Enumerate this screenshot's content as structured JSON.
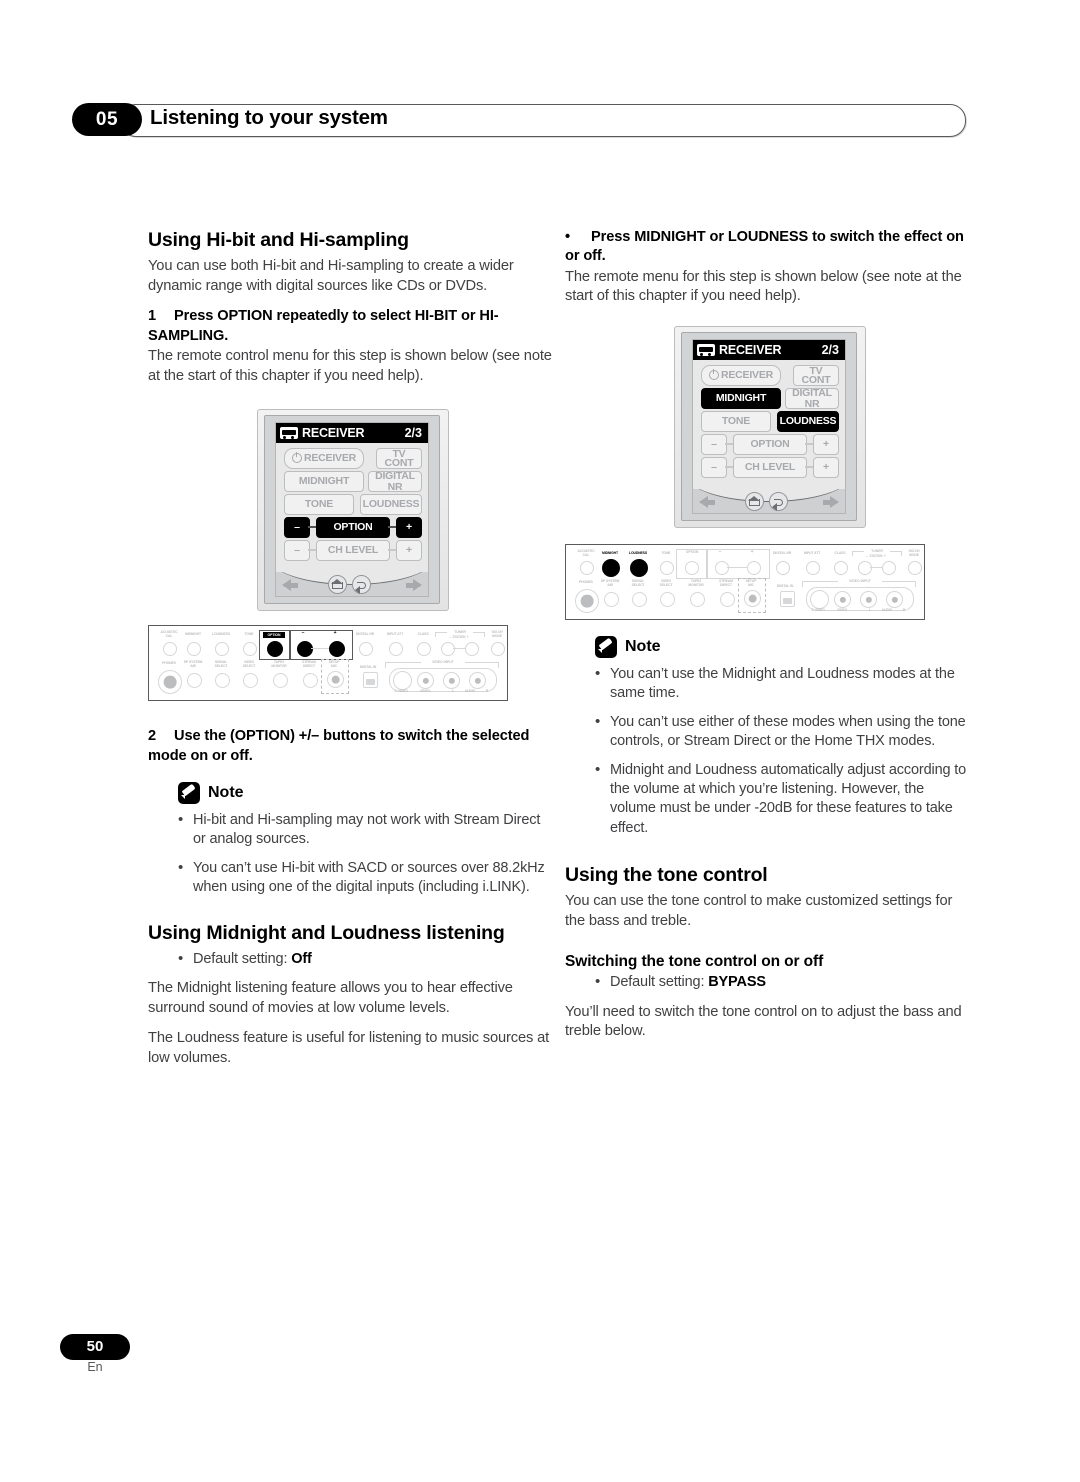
{
  "header": {
    "chapter_number": "05",
    "title": "Listening to your system"
  },
  "footer": {
    "page_number": "50",
    "language": "En"
  },
  "left_column": {
    "section1_heading": "Using Hi-bit and Hi-sampling",
    "section1_intro": "You can use both Hi-bit and Hi-sampling to create a wider dynamic range with digital sources like CDs or DVDs.",
    "step1_number": "1",
    "step1_title": "Press OPTION repeatedly to select HI-BIT or HI-SAMPLING.",
    "step1_body": "The remote control menu for this step is shown below (see note at the start of this chapter if you need help).",
    "step2_number": "2",
    "step2_title": "Use the (OPTION) +/– buttons to switch the selected mode on or off.",
    "note_label": "Note",
    "notes": [
      "Hi-bit and Hi-sampling may not work with Stream Direct or analog sources.",
      "You can’t use Hi-bit with SACD or sources over 88.2kHz when using one of the digital inputs (including i.LINK)."
    ],
    "section2_heading": "Using Midnight and Loudness listening",
    "section2_default_prefix": "Default setting: ",
    "section2_default_value": "Off",
    "section2_para1": "The Midnight listening feature allows you to hear effective surround sound of movies at low volume levels.",
    "section2_para2": "The Loudness feature is useful for listening to music sources at low volumes."
  },
  "right_column": {
    "bullet_step_title": "Press MIDNIGHT or LOUDNESS to switch the effect on or off.",
    "bullet_step_body": "The remote menu for this step is shown below (see note at the start of this chapter if you need help).",
    "note_label": "Note",
    "notes": [
      "You can’t use the Midnight and Loudness modes at the same time.",
      "You can’t use either of these modes when using the tone controls, or Stream Direct or the Home THX modes.",
      "Midnight and Loudness automatically adjust according to the volume at which you’re listening. However, the volume must be under -20dB for these features to take effect."
    ],
    "section_heading": "Using the tone control",
    "section_intro": "You can use the tone control to make customized settings for the bass and treble.",
    "subheading": "Switching the tone control on or off",
    "default_prefix": "Default setting: ",
    "default_value": "BYPASS",
    "closing_para": "You’ll need to switch the tone control on to adjust the bass and treble below."
  },
  "remote_left": {
    "device_label": "RECEIVER",
    "page_indicator": "2/3",
    "keys": [
      {
        "label": "RECEIVER",
        "highlighted": false
      },
      {
        "label": "TV CONT",
        "highlighted": false
      },
      {
        "label": "MIDNIGHT",
        "highlighted": false
      },
      {
        "label": "DIGITAL NR",
        "highlighted": false
      },
      {
        "label": "TONE",
        "highlighted": false
      },
      {
        "label": "LOUDNESS",
        "highlighted": false
      },
      {
        "label": "OPTION",
        "highlighted": true
      },
      {
        "label": "CH LEVEL",
        "highlighted": false
      }
    ],
    "minus_label": "–",
    "plus_label": "+",
    "option_minus_highlighted": true,
    "option_plus_highlighted": true,
    "chlevel_minus_highlighted": false,
    "chlevel_plus_highlighted": false
  },
  "remote_right": {
    "device_label": "RECEIVER",
    "page_indicator": "2/3",
    "keys": [
      {
        "label": "RECEIVER",
        "highlighted": false
      },
      {
        "label": "TV CONT",
        "highlighted": false
      },
      {
        "label": "MIDNIGHT",
        "highlighted": true
      },
      {
        "label": "DIGITAL NR",
        "highlighted": false
      },
      {
        "label": "TONE",
        "highlighted": false
      },
      {
        "label": "LOUDNESS",
        "highlighted": true
      },
      {
        "label": "OPTION",
        "highlighted": false
      },
      {
        "label": "CH LEVEL",
        "highlighted": false
      }
    ],
    "minus_label": "–",
    "plus_label": "+",
    "option_minus_highlighted": false,
    "option_plus_highlighted": false,
    "chlevel_minus_highlighted": false,
    "chlevel_plus_highlighted": false
  },
  "front_panel": {
    "top_row_labels": [
      "ACOUSTIC CAL",
      "MIDNIGHT",
      "LOUDNESS",
      "TONE",
      "OPTION",
      "–",
      "+",
      "DIGITAL NR",
      "INPUT ATT",
      "CLASS",
      "– STATION +",
      "SIG.CH MODE"
    ],
    "tuner_group_label": "TUNER",
    "bottom_row_labels": [
      "PHONES",
      "SP SYSTEM A/B",
      "SIGNAL SELECT",
      "VIDEO SELECT",
      "TAPE 2 MONITOR",
      "STREAM DIRECT",
      "SETUP MIC",
      "DIGITAL IN"
    ],
    "video_input_group_label": "VIDEO INPUT",
    "jack_labels": [
      "S-VIDEO",
      "VIDEO",
      "L",
      "AUDIO",
      "R"
    ],
    "left_panel_highlight": [
      "OPTION",
      "–",
      "+"
    ],
    "right_panel_highlight": [
      "MIDNIGHT",
      "LOUDNESS"
    ]
  }
}
